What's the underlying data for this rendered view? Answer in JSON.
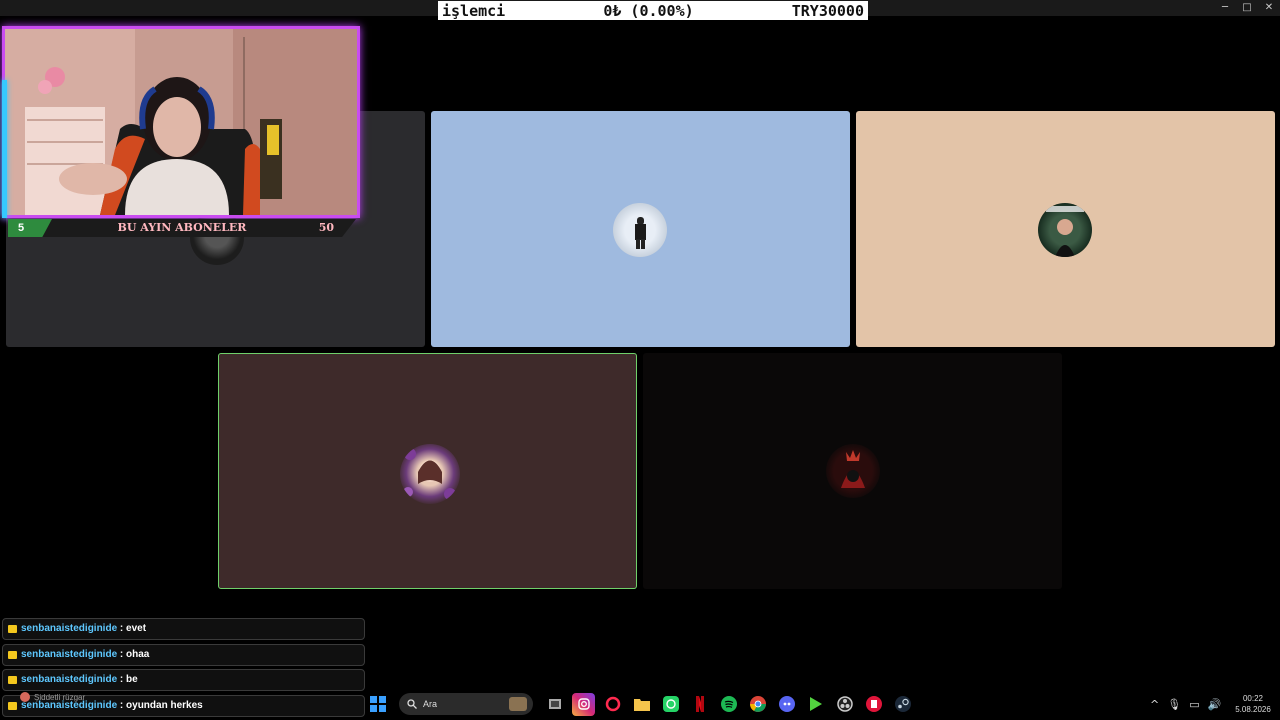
{
  "ticker": {
    "symbol": "işlemci",
    "change": "0₺ (0.00%)",
    "target": "TRY30000"
  },
  "window_controls": {
    "minimize": "─",
    "maximize": "□",
    "close": "✕"
  },
  "tiles": {
    "colors": {
      "dark": "#2b2b2e",
      "blue": "#9fbadf",
      "peach": "#e3c4a8",
      "brown": "#3e2a2a",
      "black": "#0a0808"
    },
    "active_border": "#6fd06a"
  },
  "subs_bar": {
    "left_count": "5",
    "title": "BU AYIN ABONELER",
    "right_count": "50"
  },
  "chat": [
    {
      "user": "senbanaistediginide",
      "text": " : evet"
    },
    {
      "user": "senbanaistediginide",
      "text": " : ohaa"
    },
    {
      "user": "senbanaistediginide",
      "text": " : be"
    },
    {
      "user": "senbanaistediginide",
      "text": " : oyundan herkes"
    }
  ],
  "weather": {
    "label": "Şiddetli rüzgar"
  },
  "taskbar": {
    "search_placeholder": "Ara",
    "apps": [
      "start-icon",
      "search",
      "widget-icon",
      "task-view-icon",
      "instagram-icon",
      "opera-gx-icon",
      "file-explorer-icon",
      "whatsapp-icon",
      "netflix-icon",
      "spotify-icon",
      "chrome-icon",
      "discord-icon",
      "game-launcher-icon",
      "obs-icon",
      "app-red-icon",
      "steam-icon"
    ]
  },
  "tray": {
    "chevron": "^",
    "mic": "🎙",
    "display": "▭",
    "volume": "🔊"
  },
  "clock": {
    "time": "00:22",
    "date": "5.08.2026"
  }
}
